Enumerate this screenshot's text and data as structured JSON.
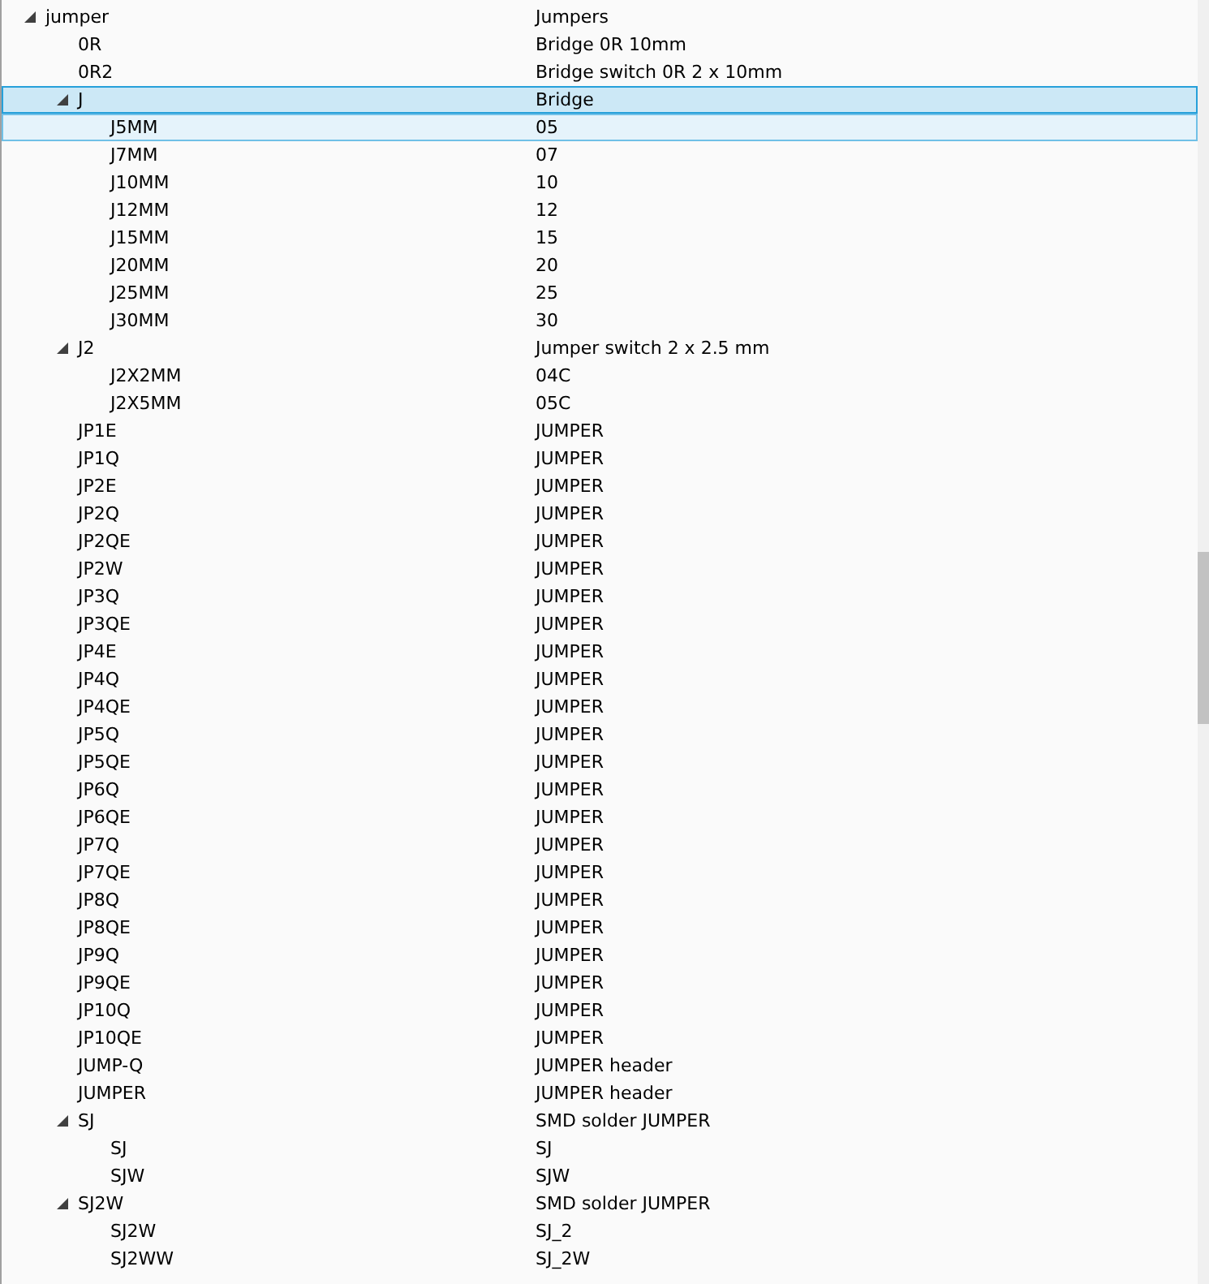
{
  "tree": [
    {
      "name": "jumper",
      "description": "Jumpers",
      "expanded": true,
      "selected": false,
      "hovered": false,
      "children": [
        {
          "name": "0R",
          "description": "Bridge 0R 10mm",
          "selected": false,
          "hovered": false
        },
        {
          "name": "0R2",
          "description": "Bridge switch 0R 2 x 10mm",
          "selected": false,
          "hovered": false
        },
        {
          "name": "J",
          "description": "Bridge",
          "expanded": true,
          "selected": true,
          "hovered": false,
          "children": [
            {
              "name": "J5MM",
              "description": "05",
              "selected": false,
              "hovered": true
            },
            {
              "name": "J7MM",
              "description": "07",
              "selected": false,
              "hovered": false
            },
            {
              "name": "J10MM",
              "description": "10",
              "selected": false,
              "hovered": false
            },
            {
              "name": "J12MM",
              "description": "12",
              "selected": false,
              "hovered": false
            },
            {
              "name": "J15MM",
              "description": "15",
              "selected": false,
              "hovered": false
            },
            {
              "name": "J20MM",
              "description": "20",
              "selected": false,
              "hovered": false
            },
            {
              "name": "J25MM",
              "description": "25",
              "selected": false,
              "hovered": false
            },
            {
              "name": "J30MM",
              "description": "30",
              "selected": false,
              "hovered": false
            }
          ]
        },
        {
          "name": "J2",
          "description": "Jumper switch 2 x 2.5 mm",
          "expanded": true,
          "selected": false,
          "hovered": false,
          "children": [
            {
              "name": "J2X2MM",
              "description": "04C",
              "selected": false,
              "hovered": false
            },
            {
              "name": "J2X5MM",
              "description": "05C",
              "selected": false,
              "hovered": false
            }
          ]
        },
        {
          "name": "JP1E",
          "description": "JUMPER",
          "selected": false,
          "hovered": false
        },
        {
          "name": "JP1Q",
          "description": "JUMPER",
          "selected": false,
          "hovered": false
        },
        {
          "name": "JP2E",
          "description": "JUMPER",
          "selected": false,
          "hovered": false
        },
        {
          "name": "JP2Q",
          "description": "JUMPER",
          "selected": false,
          "hovered": false
        },
        {
          "name": "JP2QE",
          "description": "JUMPER",
          "selected": false,
          "hovered": false
        },
        {
          "name": "JP2W",
          "description": "JUMPER",
          "selected": false,
          "hovered": false
        },
        {
          "name": "JP3Q",
          "description": "JUMPER",
          "selected": false,
          "hovered": false
        },
        {
          "name": "JP3QE",
          "description": "JUMPER",
          "selected": false,
          "hovered": false
        },
        {
          "name": "JP4E",
          "description": "JUMPER",
          "selected": false,
          "hovered": false
        },
        {
          "name": "JP4Q",
          "description": "JUMPER",
          "selected": false,
          "hovered": false
        },
        {
          "name": "JP4QE",
          "description": "JUMPER",
          "selected": false,
          "hovered": false
        },
        {
          "name": "JP5Q",
          "description": "JUMPER",
          "selected": false,
          "hovered": false
        },
        {
          "name": "JP5QE",
          "description": "JUMPER",
          "selected": false,
          "hovered": false
        },
        {
          "name": "JP6Q",
          "description": "JUMPER",
          "selected": false,
          "hovered": false
        },
        {
          "name": "JP6QE",
          "description": "JUMPER",
          "selected": false,
          "hovered": false
        },
        {
          "name": "JP7Q",
          "description": "JUMPER",
          "selected": false,
          "hovered": false
        },
        {
          "name": "JP7QE",
          "description": "JUMPER",
          "selected": false,
          "hovered": false
        },
        {
          "name": "JP8Q",
          "description": "JUMPER",
          "selected": false,
          "hovered": false
        },
        {
          "name": "JP8QE",
          "description": "JUMPER",
          "selected": false,
          "hovered": false
        },
        {
          "name": "JP9Q",
          "description": "JUMPER",
          "selected": false,
          "hovered": false
        },
        {
          "name": "JP9QE",
          "description": "JUMPER",
          "selected": false,
          "hovered": false
        },
        {
          "name": "JP10Q",
          "description": "JUMPER",
          "selected": false,
          "hovered": false
        },
        {
          "name": "JP10QE",
          "description": "JUMPER",
          "selected": false,
          "hovered": false
        },
        {
          "name": "JUMP-Q",
          "description": "JUMPER header",
          "selected": false,
          "hovered": false
        },
        {
          "name": "JUMPER",
          "description": "JUMPER header",
          "selected": false,
          "hovered": false
        },
        {
          "name": "SJ",
          "description": "SMD solder JUMPER",
          "expanded": true,
          "selected": false,
          "hovered": false,
          "children": [
            {
              "name": "SJ",
              "description": "SJ",
              "selected": false,
              "hovered": false
            },
            {
              "name": "SJW",
              "description": "SJW",
              "selected": false,
              "hovered": false
            }
          ]
        },
        {
          "name": "SJ2W",
          "description": "SMD solder JUMPER",
          "expanded": true,
          "selected": false,
          "hovered": false,
          "children": [
            {
              "name": "SJ2W",
              "description": "SJ_2",
              "selected": false,
              "hovered": false
            },
            {
              "name": "SJ2WW",
              "description": "SJ_2W",
              "selected": false,
              "hovered": false
            }
          ]
        }
      ]
    }
  ]
}
